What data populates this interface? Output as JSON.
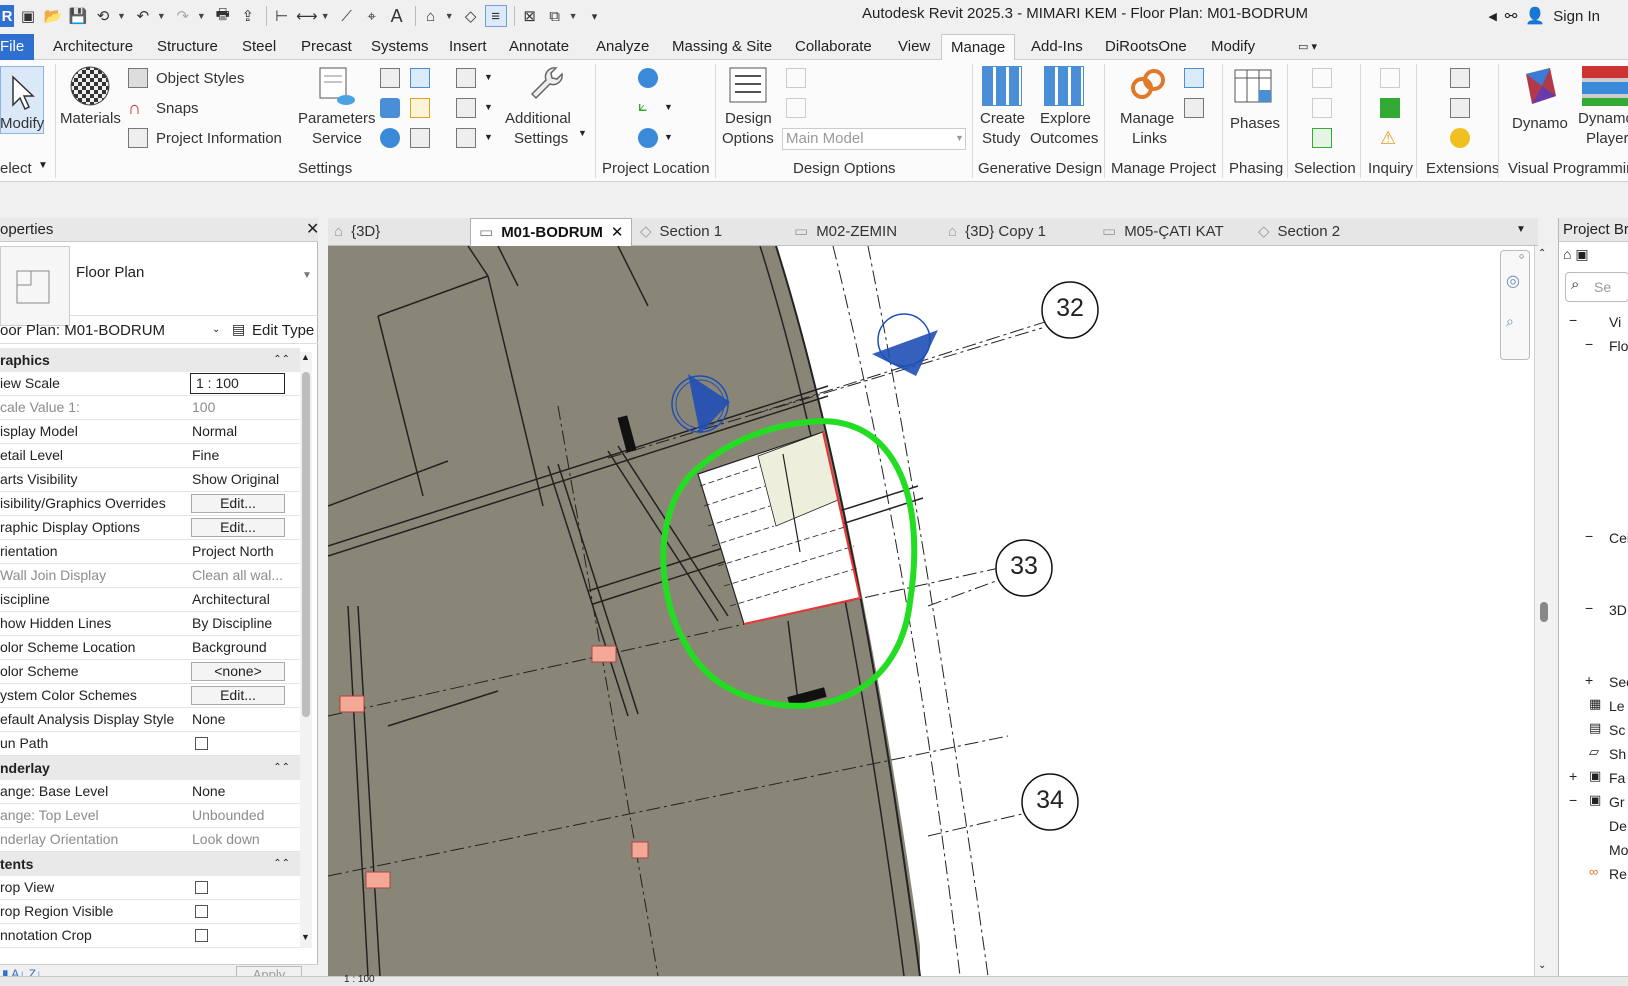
{
  "window": {
    "title": "Autodesk Revit 2025.3 - MIMARI KEM - Floor Plan: M01-BODRUM",
    "sign_in": "Sign In"
  },
  "menu_tabs": [
    "File",
    "Architecture",
    "Structure",
    "Steel",
    "Precast",
    "Systems",
    "Insert",
    "Annotate",
    "Analyze",
    "Massing & Site",
    "Collaborate",
    "View",
    "Manage",
    "Add-Ins",
    "DiRootsOne",
    "Modify"
  ],
  "active_menu_tab": "Manage",
  "ribbon": {
    "modify": "Modify",
    "select": "elect",
    "materials": "Materials",
    "object_styles": "Object  Styles",
    "snaps": "Snaps",
    "project_information": "Project  Information",
    "parameters_service_1": "Parameters",
    "parameters_service_2": "Service",
    "additional_settings_1": "Additional",
    "additional_settings_2": "Settings",
    "settings_group": "Settings",
    "project_location_group": "Project Location",
    "design_options_1": "Design",
    "design_options_2": "Options",
    "main_model": "Main Model",
    "design_options_group": "Design Options",
    "create_study_1": "Create",
    "create_study_2": "Study",
    "explore_outcomes_1": "Explore",
    "explore_outcomes_2": "Outcomes",
    "generative_design_group": "Generative Design",
    "manage_links_1": "Manage",
    "manage_links_2": "Links",
    "manage_project_group": "Manage Project",
    "phases": "Phases",
    "phasing_group": "Phasing",
    "selection_group": "Selection",
    "inquiry_group": "Inquiry",
    "extensions_group": "Extensions",
    "dynamo": "Dynamo",
    "dynamo_player_1": "Dynamo",
    "dynamo_player_2": "Player",
    "visual_programming_group": "Visual Programmin"
  },
  "properties": {
    "header": "operties",
    "type_name": "Floor Plan",
    "instance": "oor Plan: M01-BODRUM",
    "edit_type": "Edit Type",
    "apply": "Apply",
    "cat_graphics": "raphics",
    "cat_underlay": "nderlay",
    "cat_extents": "tents",
    "rows": {
      "view_scale": [
        "iew Scale",
        "1 : 100"
      ],
      "scale_value": [
        "cale Value    1:",
        "100"
      ],
      "display_model": [
        "isplay Model",
        "Normal"
      ],
      "detail_level": [
        "etail Level",
        "Fine"
      ],
      "parts_visibility": [
        "arts Visibility",
        "Show Original"
      ],
      "vg_overrides": [
        "isibility/Graphics Overrides",
        "Edit..."
      ],
      "graphic_display": [
        "raphic Display Options",
        "Edit..."
      ],
      "orientation": [
        "rientation",
        "Project North"
      ],
      "wall_join": [
        "Wall Join Display",
        "Clean all wal..."
      ],
      "discipline": [
        "iscipline",
        "Architectural"
      ],
      "hidden_lines": [
        "how Hidden Lines",
        "By Discipline"
      ],
      "color_scheme_loc": [
        "olor Scheme Location",
        "Background"
      ],
      "color_scheme": [
        "olor Scheme",
        "<none>"
      ],
      "system_color": [
        "ystem Color Schemes",
        "Edit..."
      ],
      "default_analysis": [
        "efault Analysis Display Style",
        "None"
      ],
      "sun_path": [
        "un Path",
        ""
      ],
      "range_base": [
        "ange: Base Level",
        "None"
      ],
      "range_top": [
        "ange: Top Level",
        "Unbounded"
      ],
      "underlay_orient": [
        "nderlay Orientation",
        "Look down"
      ],
      "crop_view": [
        "rop View",
        ""
      ],
      "crop_region": [
        "rop Region Visible",
        ""
      ],
      "annotation_crop": [
        "nnotation Crop",
        ""
      ]
    }
  },
  "view_tabs": [
    "{3D}",
    "M01-BODRUM",
    "Section 1",
    "M02-ZEMIN",
    "{3D} Copy 1",
    "M05-ÇATI KAT",
    "Section 2"
  ],
  "active_view_tab": "M01-BODRUM",
  "grid_bubbles": [
    "32",
    "33",
    "34"
  ],
  "browser": {
    "header": "Project Br",
    "search": "Se",
    "items": [
      "Vi",
      "Flo",
      "Cei",
      "3D",
      "Sec",
      "Le",
      "Sc",
      "Sh",
      "Fa",
      "Gr",
      "De",
      "Mo",
      "Re"
    ]
  },
  "status": {
    "scale": "1 : 100"
  },
  "colors": {
    "accent": "#2f6fcf",
    "slab": "#8a8677",
    "markup": "#22dd22"
  }
}
